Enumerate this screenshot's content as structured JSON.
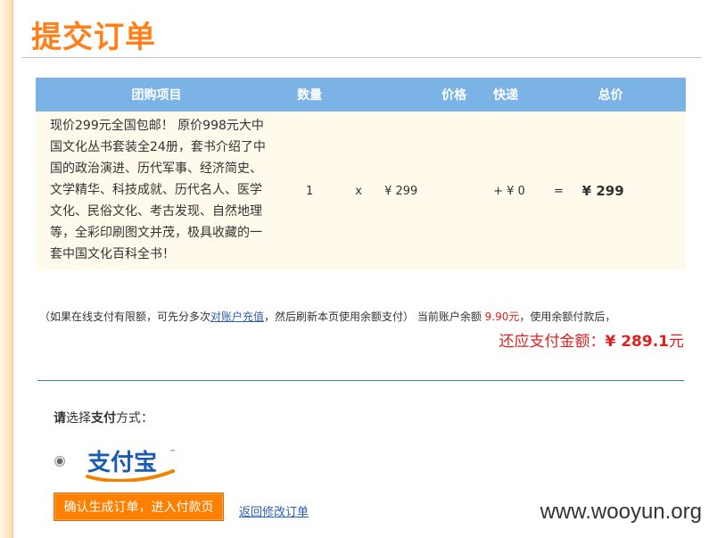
{
  "page": {
    "title": "提交订单"
  },
  "table": {
    "headers": {
      "item": "团购项目",
      "qty": "数量",
      "price": "价格",
      "shipping": "快递",
      "total": "总价"
    },
    "row": {
      "description": "现价299元全国包邮！ 原价998元大中国文化丛书套装全24册，套书介绍了中国的政治演进、历代军事、经济简史、文学精华、科技成就、历代名人、医学文化、民俗文化、考古发现、自然地理等，全彩印刷图文并茂，极具收藏的一套中国文化百科全书！",
      "qty": "1",
      "times": "x",
      "price": "¥ 299",
      "shipping": "+ ¥ 0",
      "equals": "=",
      "total": "¥ 299"
    }
  },
  "note": {
    "prefix": "（如果在线支付有限额，可先分多次",
    "link": "对账户充值",
    "middle": "，然后刷新本页使用余额支付）  当前账户余额 ",
    "balance": "9.90元",
    "suffix": "，使用余额付款后，"
  },
  "due": {
    "label": "还应支付金额：",
    "amount": "¥ 289.1",
    "unit": "元"
  },
  "payment": {
    "choose_prefix": "请",
    "choose_mid1": "选择",
    "choose_bold": "支付",
    "choose_suffix": "方式：",
    "logo_text": "支付宝",
    "logo_tm": "™"
  },
  "actions": {
    "confirm": "确认生成订单，进入付款页",
    "back": "返回修改订单"
  },
  "watermark": "www.wooyun.org",
  "colors": {
    "accent_orange": "#ff7f1a",
    "header_blue": "#7cb3e6",
    "row_bg": "#fffaeb",
    "alert_red": "#e02020",
    "link_blue": "#2b5fb5"
  }
}
